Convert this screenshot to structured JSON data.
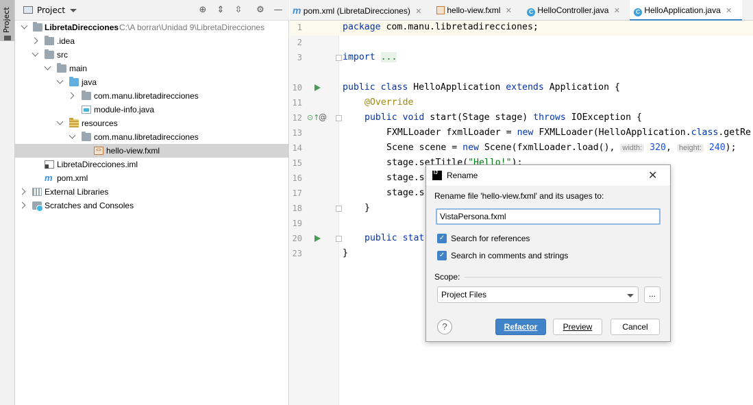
{
  "stripe": {
    "label": "Project"
  },
  "project_panel": {
    "title": "Project",
    "toolbar_icons": [
      "locate-icon",
      "expand-all-icon",
      "collapse-all-icon",
      "gear-icon",
      "minimize-icon"
    ],
    "tree": [
      {
        "label": "LibretaDirecciones",
        "path": "C:\\A borrar\\Unidad 9\\LibretaDirecciones",
        "bold": true
      },
      {
        "label": ".idea"
      },
      {
        "label": "src"
      },
      {
        "label": "main"
      },
      {
        "label": "java"
      },
      {
        "label": "com.manu.libretadirecciones"
      },
      {
        "label": "module-info.java"
      },
      {
        "label": "resources"
      },
      {
        "label": "com.manu.libretadirecciones"
      },
      {
        "label": "hello-view.fxml",
        "selected": true
      },
      {
        "label": "LibretaDirecciones.iml"
      },
      {
        "label": "pom.xml"
      },
      {
        "label": "External Libraries"
      },
      {
        "label": "Scratches and Consoles"
      }
    ]
  },
  "editor_tabs": [
    {
      "label": "pom.xml (LibretaDirecciones)",
      "icon": "maven-icon"
    },
    {
      "label": "hello-view.fxml",
      "icon": "fxml-icon"
    },
    {
      "label": "HelloController.java",
      "icon": "class-icon"
    },
    {
      "label": "HelloApplication.java",
      "icon": "class-icon",
      "active": true
    }
  ],
  "editor": {
    "line_numbers": [
      "1",
      "2",
      "3",
      "10",
      "11",
      "12",
      "13",
      "14",
      "15",
      "16",
      "17",
      "18",
      "19",
      "20",
      "23"
    ],
    "lines": {
      "l1_kw": "package",
      "l1_rest": " com.manu.libretadirecciones;",
      "l3_kw": "import",
      "l3_dots": "...",
      "l10_kw1": "public class",
      "l10_name": " HelloApplication ",
      "l10_kw2": "extends",
      "l10_rest": " Application {",
      "l11_anno": "@Override",
      "l12_kw1": "public void",
      "l12_mid": " start(Stage stage) ",
      "l12_kw2": "throws",
      "l12_rest": " IOException {",
      "l13_a": "FXMLLoader fxmlLoader = ",
      "l13_kw": "new",
      "l13_b": " FXMLLoader(HelloApplication.",
      "l13_kw2": "class",
      "l13_c": ".getRe",
      "l14_a": "Scene scene = ",
      "l14_kw": "new",
      "l14_b": " Scene(fxmlLoader.load(), ",
      "l14_hint_w": "width:",
      "l14_num_w": "320",
      "l14_sep": ", ",
      "l14_hint_h": "height:",
      "l14_num_h": "240",
      "l14_end": ");",
      "l15_a": "stage.setTitle(",
      "l15_str": "\"Hello!\"",
      "l15_end": ");",
      "l16": "stage.s",
      "l17": "stage.s",
      "l18": "}",
      "l20_kw": "public stat",
      "l23": "}"
    }
  },
  "dialog": {
    "title": "Rename",
    "prompt": "Rename file 'hello-view.fxml' and its usages to:",
    "input_value": "VistaPersona.fxml",
    "search_references": {
      "label": "Search for references",
      "checked": true
    },
    "search_comments": {
      "label": "Search in comments and strings",
      "checked": true
    },
    "scope_label": "Scope:",
    "scope_value": "Project Files",
    "more_label": "...",
    "help_label": "?",
    "buttons": {
      "refactor": "Refactor",
      "preview": "Preview",
      "cancel": "Cancel"
    }
  }
}
